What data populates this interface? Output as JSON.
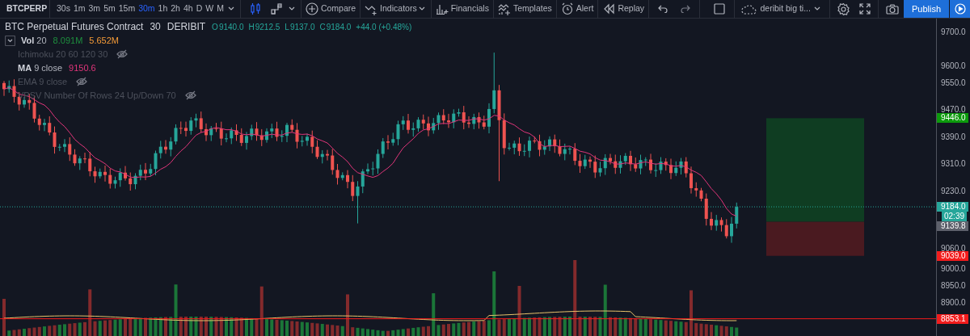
{
  "toolbar": {
    "symbol": "BTCPERP",
    "intervals": [
      {
        "label": "30s",
        "selected": false
      },
      {
        "label": "1m",
        "selected": false
      },
      {
        "label": "3m",
        "selected": false
      },
      {
        "label": "5m",
        "selected": false
      },
      {
        "label": "15m",
        "selected": false
      },
      {
        "label": "30m",
        "selected": true
      },
      {
        "label": "1h",
        "selected": false
      },
      {
        "label": "2h",
        "selected": false
      },
      {
        "label": "4h",
        "selected": false
      },
      {
        "label": "D",
        "selected": false
      },
      {
        "label": "W",
        "selected": false
      },
      {
        "label": "M",
        "selected": false
      }
    ],
    "tools": [
      {
        "kind": "compare",
        "label": "Compare"
      },
      {
        "kind": "indicators",
        "label": "Indicators"
      },
      {
        "kind": "financials",
        "label": "Financials"
      },
      {
        "kind": "templates",
        "label": "Templates"
      },
      {
        "kind": "alert",
        "label": "Alert"
      },
      {
        "kind": "replay",
        "label": "Replay"
      }
    ],
    "layout_name": "deribit big ti...",
    "publish": "Publish"
  },
  "legend": {
    "title": "BTC Perpetual Futures Contract",
    "interval": "30",
    "exchange": "DERIBIT",
    "ohlc": [
      {
        "label": "O",
        "value": "9140.0"
      },
      {
        "label": "H",
        "value": "9212.5"
      },
      {
        "label": "L",
        "value": "9137.0"
      },
      {
        "label": "C",
        "value": "9184.0"
      }
    ],
    "change": "+44.0 (+0.48%)"
  },
  "indicators": [
    {
      "name": "Vol",
      "params": "20",
      "hidden": false,
      "values": [
        {
          "text": "8.091M",
          "color": "#1e8f3e"
        },
        {
          "text": "5.652M",
          "color": "#f59b38"
        }
      ]
    },
    {
      "name": "Ichimoku",
      "params": "20 60 120 30",
      "hidden": true
    },
    {
      "name": "MA",
      "params": "9 close",
      "hidden": false,
      "values": [
        {
          "text": "9150.6",
          "color": "#e0357a"
        }
      ]
    },
    {
      "name": "EMA",
      "params": "9 close",
      "hidden": true
    },
    {
      "name": "VPSV",
      "params": "Number Of Rows 24 Up/Down 70",
      "hidden": true
    }
  ],
  "price_axis": {
    "ticks": [
      "9700.0",
      "9600.0",
      "9550.0",
      "9470.0",
      "9390.0",
      "9310.0",
      "9230.0",
      "9060.0",
      "9000.0",
      "8950.0",
      "8900.0"
    ],
    "badges": [
      {
        "kind": "price",
        "text": "9446.0",
        "color": "#0c9a0c"
      },
      {
        "kind": "price",
        "text": "9184.0",
        "color": "#26a69a"
      },
      {
        "kind": "countdown",
        "text": "02:39",
        "color": "#26a69a"
      },
      {
        "kind": "price",
        "text": "9139.8",
        "color": "#5d606b"
      },
      {
        "kind": "price",
        "text": "9039.0",
        "color": "#f21c1c"
      },
      {
        "kind": "price",
        "text": "8853.1",
        "color": "#f21c1c"
      }
    ]
  }
}
